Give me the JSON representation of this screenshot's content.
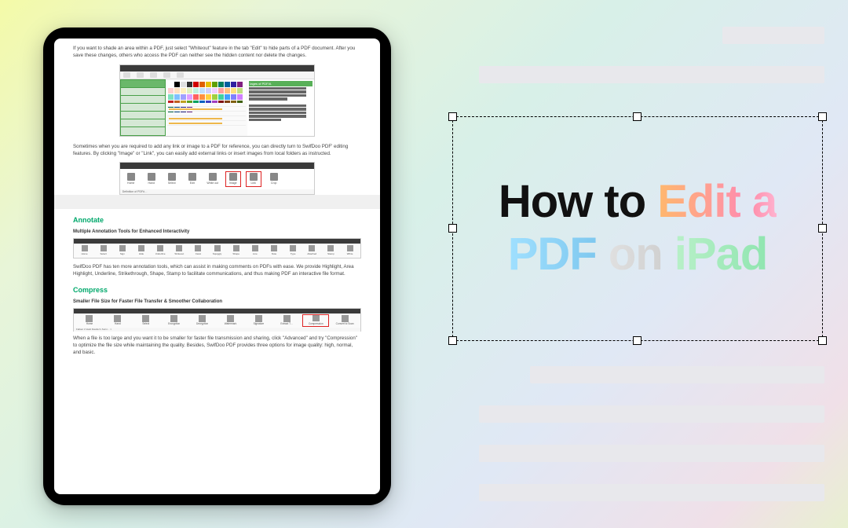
{
  "title": {
    "w1": "How",
    "w2": "to",
    "w3": "Edit",
    "w4": "a",
    "w5": "PDF",
    "w6": "on",
    "w7": "iPad"
  },
  "doc": {
    "para1": "If you want to shade an area within a PDF, just select \"Whiteout\" feature in the tab \"Edit\" to hide parts of a PDF document. After you save these changes, others who access the PDF can neither see the hidden content nor delete the changes.",
    "img1_heading": "tages of PDF/А",
    "para2": "Sometimes when you are required to add any link or image to a PDF for reference, you can directly turn to SwifDoo PDF' editing features. By clicking \"Image\" or \"Link\", you can easily add external links or insert images from local folders as instructed.",
    "toolbar2": {
      "items": [
        "Home",
        "Hand",
        "Select",
        "Edit",
        "White out",
        "Image",
        "Link",
        "Crop"
      ],
      "bottom": "Definition of PDF#…"
    },
    "annotate": {
      "heading": "Annotate",
      "sub": "Multiple Annotation Tools for Enhanced Interactivity",
      "items": [
        "Home",
        "Select",
        "Sign",
        "Hide",
        "Underline",
        "Strikeout",
        "Caret",
        "Squiggly",
        "Shape",
        "Line",
        "Note",
        "Type",
        "Attached",
        "Stamp",
        "White"
      ],
      "text": "SwifDoo PDF has ten more annotation tools, which can assist in making comments on PDFs with ease. We provide Highlight, Area Highlight, Underline, Strikethrough, Shape, Stamp to facilitate communications, and thus making PDF an interactive file format."
    },
    "compress": {
      "heading": "Compress",
      "sub": "Smaller File Size for Faster File Transfer & Smoother Collaboration",
      "items": [
        "Home",
        "Hand",
        "Select",
        "Encryption",
        "Decryption",
        "Watermark",
        "Signature",
        "Extract T…",
        "Compression",
        "Convert to Scan"
      ],
      "bottom": "Fallout 4 Vault Dweller's Survi… ×",
      "text": "When a file is too large and you want it to be smaller for faster file transmission and sharing, click \"Advanced\" and try \"Compression\" to optimize the file size while maintaining the quality. Besides, SwifDoo PDF provides three options for image quality: high, normal, and basic."
    }
  },
  "palette_colors": [
    "#ffffff",
    "#000000",
    "#e0e0e0",
    "#333333",
    "#d00000",
    "#e06000",
    "#e8c000",
    "#60a000",
    "#008060",
    "#0060a0",
    "#3020a0",
    "#802080",
    "#ffd0d0",
    "#ffe0c0",
    "#fff0c0",
    "#e0f0c0",
    "#c0f0e0",
    "#c0e0ff",
    "#d0d0ff",
    "#f0d0ff",
    "#ffa0a0",
    "#ffc080",
    "#ffe080",
    "#c0e080",
    "#80e0c0",
    "#80c0ff",
    "#a0a0ff",
    "#e0a0ff",
    "#ff6060",
    "#ff9040",
    "#ffd040",
    "#a0d040",
    "#40d0a0",
    "#40a0ff",
    "#8080ff",
    "#d080ff",
    "#c02020",
    "#c06020",
    "#c0a020",
    "#60a020",
    "#00a060",
    "#0060c0",
    "#4040c0",
    "#a040c0",
    "#801010",
    "#804010",
    "#806010",
    "#406010",
    "#006040",
    "#004080",
    "#202080",
    "#602080"
  ]
}
